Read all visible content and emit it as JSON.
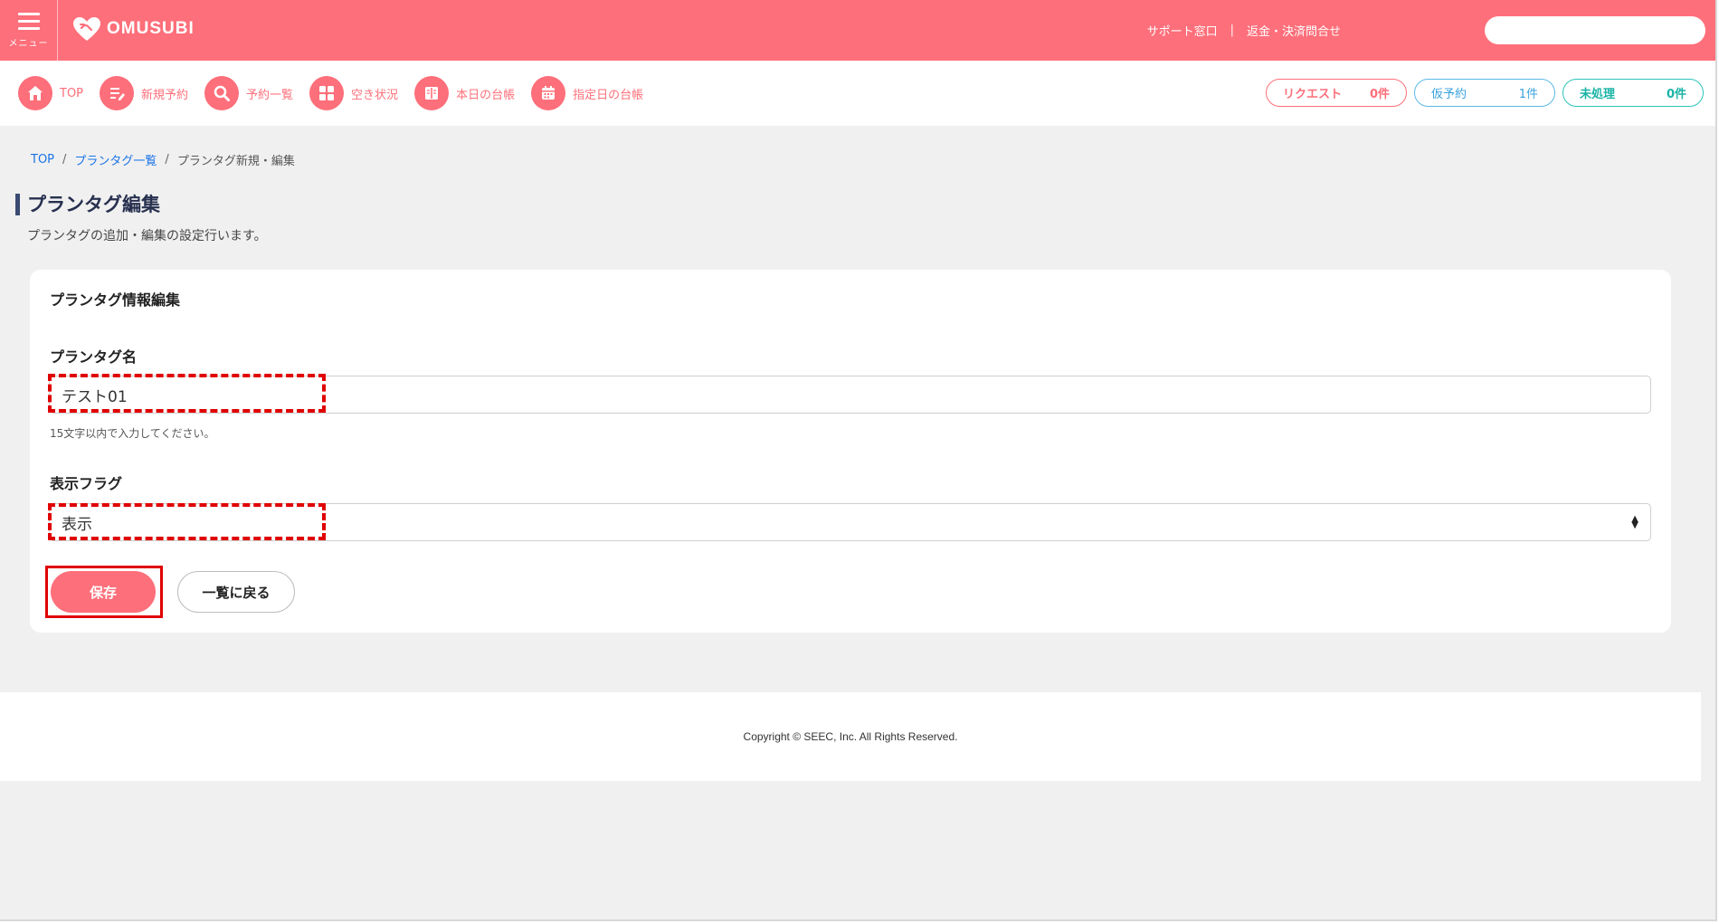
{
  "header": {
    "menu_label": "メニュー",
    "logo_text": "OMUSUBI",
    "links": [
      "サポート窓口",
      "返金・決済問合せ"
    ],
    "separator": "|",
    "search_value": ""
  },
  "nav": {
    "items": [
      {
        "label": "TOP",
        "icon": "home-icon"
      },
      {
        "label": "新規予約",
        "icon": "new-reservation-icon"
      },
      {
        "label": "予約一覧",
        "icon": "search-icon"
      },
      {
        "label": "空き状況",
        "icon": "grid-icon"
      },
      {
        "label": "本日の台帳",
        "icon": "book-icon"
      },
      {
        "label": "指定日の台帳",
        "icon": "calendar-icon"
      }
    ]
  },
  "status": {
    "request": {
      "label": "リクエスト",
      "count": "0件"
    },
    "tentative": {
      "label": "仮予約",
      "count": "1件"
    },
    "unprocessed": {
      "label": "未処理",
      "count": "0件"
    }
  },
  "breadcrumb": {
    "items": [
      "TOP",
      "プランタグ一覧",
      "プランタグ新規・編集"
    ],
    "separator": "/"
  },
  "page": {
    "title": "プランタグ編集",
    "description": "プランタグの追加・編集の設定行います。"
  },
  "form": {
    "card_title": "プランタグ情報編集",
    "name_label": "プランタグ名",
    "name_value": "テスト01",
    "name_help": "15文字以内で入力してください。",
    "flag_label": "表示フラグ",
    "flag_value": "表示",
    "save_label": "保存",
    "back_label": "一覧に戻る"
  },
  "footer": {
    "copyright": "Copyright © SEEC, Inc. All Rights Reserved."
  },
  "colors": {
    "brand": "#fd6f7a",
    "tentative": "#3aa2df",
    "unprocessed": "#1ab3a6",
    "annotation": "#e00000"
  }
}
